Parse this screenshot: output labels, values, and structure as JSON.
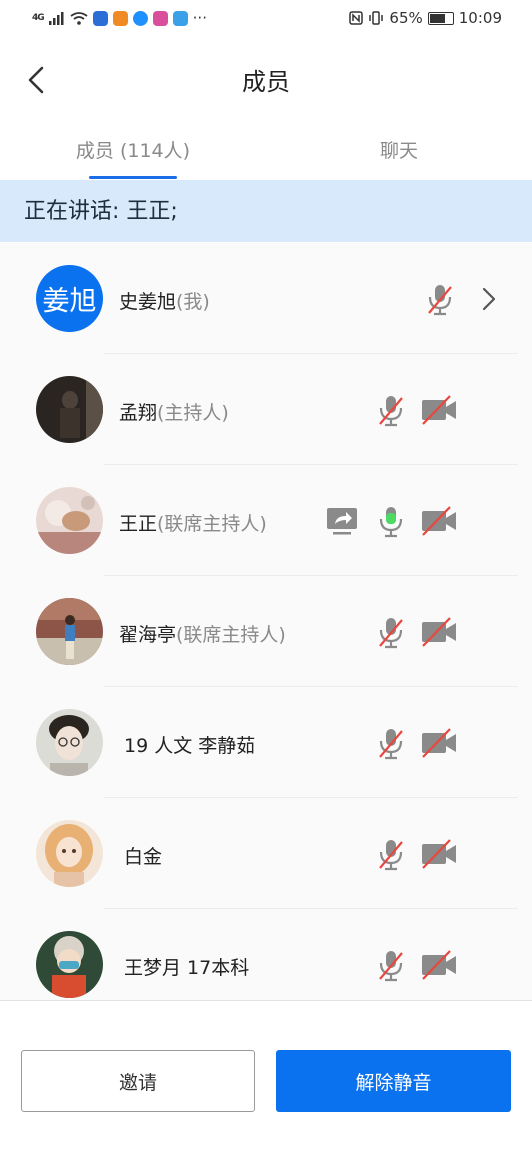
{
  "status_bar": {
    "signal": "4G",
    "more": "···",
    "battery": "65%",
    "time": "10:09"
  },
  "header": {
    "title": "成员"
  },
  "tabs": [
    {
      "label": "成员 (114人)",
      "active": true
    },
    {
      "label": "聊天",
      "active": false
    }
  ],
  "speaking": {
    "text": "正在讲话: 王正;"
  },
  "members": [
    {
      "name": "史姜旭",
      "role": "(我)",
      "avatar_text": "姜旭"
    },
    {
      "name": "孟翔",
      "role": "(主持人)"
    },
    {
      "name": "王正",
      "role": "(联席主持人)"
    },
    {
      "name": "翟海亭",
      "role": "(联席主持人)"
    },
    {
      "name": "19 人文 李静茹",
      "role": ""
    },
    {
      "name": "白金",
      "role": ""
    },
    {
      "name": "王梦月 17本科",
      "role": ""
    }
  ],
  "footer": {
    "invite_label": "邀请",
    "unmute_label": "解除静音"
  },
  "colors": {
    "accent": "#0a72ef",
    "speaking_bg": "#d7e9fb",
    "muted_slash": "#e8473f",
    "active_mic": "#4cd964"
  }
}
